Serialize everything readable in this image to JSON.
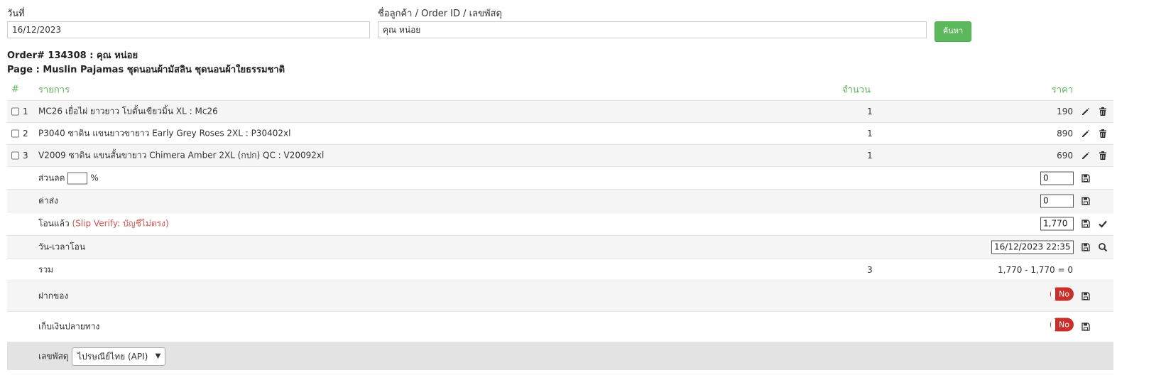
{
  "search": {
    "date_label": "วันที่",
    "date_value": "16/12/2023",
    "customer_label": "ชื่อลูกค้า / Order ID / เลขพัสดุ",
    "customer_value": "คุณ หน่อย",
    "search_button": "ค้นหา"
  },
  "order": {
    "title": "Order# 134308 : คุณ หน่อย",
    "page": "Page : Muslin Pajamas ชุดนอนผ้ามัสลิน ชุดนอนผ้าใยธรรมชาติ"
  },
  "table": {
    "headers": {
      "num": "#",
      "item": "รายการ",
      "qty": "จำนวน",
      "price": "ราคา"
    },
    "items": [
      {
        "num": "1",
        "name": "MC26 เยื่อไผ่ ยาวยาว โบตั้นเขียวมิ้น XL : Mc26",
        "qty": "1",
        "price": "190"
      },
      {
        "num": "2",
        "name": "P3040 ซาติน แขนยาวขายาว Early Grey Roses 2XL : P30402xl",
        "qty": "1",
        "price": "890"
      },
      {
        "num": "3",
        "name": "V2009 ซาติน แขนสั้นขายาว Chimera Amber 2XL (กปก) QC : V20092xl",
        "qty": "1",
        "price": "690"
      }
    ],
    "discount": {
      "label": "ส่วนลด",
      "percent_sign": "%",
      "value": "0"
    },
    "shipping": {
      "label": "ค่าส่ง",
      "value": "0"
    },
    "transferred": {
      "label": "โอนแล้ว",
      "slip_note": "(Slip Verify: บัญชีไม่ตรง)",
      "value": "1,770"
    },
    "transfer_time": {
      "label": "วัน-เวลาโอน",
      "value": "16/12/2023 22:35"
    },
    "total": {
      "label": "รวม",
      "qty": "3",
      "summary": "1,770 - 1,770 = 0"
    },
    "deposit": {
      "label": "ฝากของ",
      "toggle": "No"
    },
    "cod": {
      "label": "เก็บเงินปลายทาง",
      "toggle": "No"
    },
    "tracking": {
      "label": "เลขพัสดุ",
      "carrier": "ไปรษณีย์ไทย (API)"
    }
  },
  "colors": {
    "accent_green": "#5cb85c",
    "toggle_red": "#c9302c",
    "warning_red": "#d9534f"
  }
}
